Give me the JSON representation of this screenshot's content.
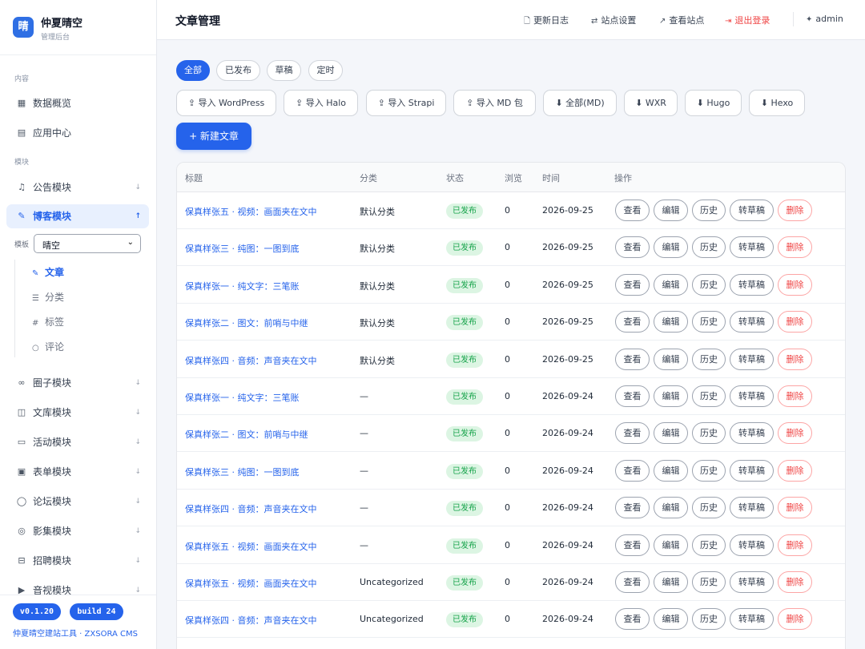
{
  "brand": {
    "logo": "晴",
    "name": "仲夏晴空",
    "subtitle": "管理后台"
  },
  "sidebar": {
    "group_content": "内容",
    "group_modules": "模块",
    "items": [
      {
        "label": "数据概览",
        "icon": "grid-icon"
      },
      {
        "label": "应用中心",
        "icon": "apps-icon"
      },
      {
        "label": "公告模块",
        "icon": "bell-icon"
      },
      {
        "label": "博客模块",
        "icon": "pen-icon"
      },
      {
        "label": "圈子模块",
        "icon": "link-icon"
      },
      {
        "label": "文库模块",
        "icon": "book-icon"
      },
      {
        "label": "活动模块",
        "icon": "calendar-icon"
      },
      {
        "label": "表单模块",
        "icon": "form-icon"
      },
      {
        "label": "论坛模块",
        "icon": "chat-icon"
      },
      {
        "label": "影集模块",
        "icon": "camera-icon"
      },
      {
        "label": "招聘模块",
        "icon": "briefcase-icon"
      },
      {
        "label": "音视模块",
        "icon": "media-icon"
      }
    ],
    "template_label": "模板",
    "template_value": "晴空",
    "blog_sub": [
      {
        "label": "文章",
        "icon": "pen-icon"
      },
      {
        "label": "分类",
        "icon": "list-icon"
      },
      {
        "label": "标签",
        "icon": "hash-icon"
      },
      {
        "label": "评论",
        "icon": "comment-icon"
      }
    ],
    "version": "v0.1.20",
    "build": "build 24",
    "footer": "仲夏晴空建站工具 · ZXSORA CMS"
  },
  "header": {
    "title": "文章管理",
    "changelog": "更新日志",
    "settings": "站点设置",
    "view_site": "查看站点",
    "logout": "退出登录",
    "user": "admin"
  },
  "filters": [
    "全部",
    "已发布",
    "草稿",
    "定时"
  ],
  "imports": [
    "导入 WordPress",
    "导入 Halo",
    "导入 Strapi",
    "导入 MD 包",
    "全部(MD)",
    "WXR",
    "Hugo",
    "Hexo"
  ],
  "new_post": "+ 新建文章",
  "table": {
    "headers": [
      "标题",
      "分类",
      "状态",
      "浏览",
      "时间",
      "操作"
    ],
    "actions": [
      "查看",
      "编辑",
      "历史",
      "转草稿",
      "删除"
    ],
    "rows": [
      {
        "title": "保真样张五 · 视频：画面夹在文中",
        "category": "默认分类",
        "status": "已发布",
        "views": "0",
        "date": "2026-09-25"
      },
      {
        "title": "保真样张三 · 纯图：一图到底",
        "category": "默认分类",
        "status": "已发布",
        "views": "0",
        "date": "2026-09-25"
      },
      {
        "title": "保真样张一 · 纯文字：三笔账",
        "category": "默认分类",
        "status": "已发布",
        "views": "0",
        "date": "2026-09-25"
      },
      {
        "title": "保真样张二 · 图文：前哨与中继",
        "category": "默认分类",
        "status": "已发布",
        "views": "0",
        "date": "2026-09-25"
      },
      {
        "title": "保真样张四 · 音频：声音夹在文中",
        "category": "默认分类",
        "status": "已发布",
        "views": "0",
        "date": "2026-09-25"
      },
      {
        "title": "保真样张一 · 纯文字：三笔账",
        "category": "—",
        "status": "已发布",
        "views": "0",
        "date": "2026-09-24"
      },
      {
        "title": "保真样张二 · 图文：前哨与中继",
        "category": "—",
        "status": "已发布",
        "views": "0",
        "date": "2026-09-24"
      },
      {
        "title": "保真样张三 · 纯图：一图到底",
        "category": "—",
        "status": "已发布",
        "views": "0",
        "date": "2026-09-24"
      },
      {
        "title": "保真样张四 · 音频：声音夹在文中",
        "category": "—",
        "status": "已发布",
        "views": "0",
        "date": "2026-09-24"
      },
      {
        "title": "保真样张五 · 视频：画面夹在文中",
        "category": "—",
        "status": "已发布",
        "views": "0",
        "date": "2026-09-24"
      },
      {
        "title": "保真样张五 · 视频：画面夹在文中",
        "category": "Uncategorized",
        "status": "已发布",
        "views": "0",
        "date": "2026-09-24"
      },
      {
        "title": "保真样张四 · 音频：声音夹在文中",
        "category": "Uncategorized",
        "status": "已发布",
        "views": "0",
        "date": "2026-09-24"
      }
    ]
  },
  "colors": {
    "accent": "#2563eb",
    "danger": "#ef4444",
    "success_bg": "#dcf5e3",
    "success_text": "#16a34a"
  }
}
